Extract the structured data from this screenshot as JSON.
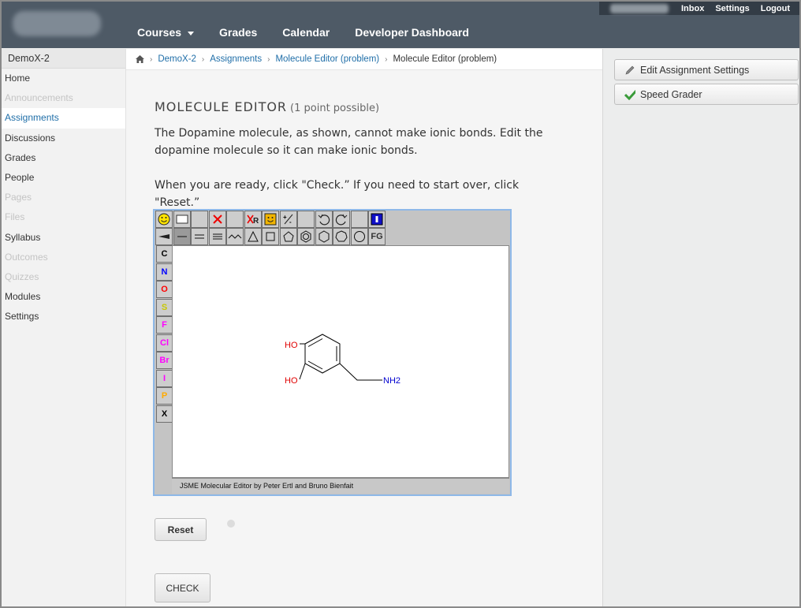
{
  "header": {
    "util_links": [
      "Inbox",
      "Settings",
      "Logout"
    ],
    "nav": [
      {
        "label": "Courses",
        "dropdown": true
      },
      {
        "label": "Grades"
      },
      {
        "label": "Calendar"
      },
      {
        "label": "Developer Dashboard"
      }
    ]
  },
  "sidebar": {
    "course": "DemoX-2",
    "items": [
      {
        "label": "Home",
        "state": "normal"
      },
      {
        "label": "Announcements",
        "state": "dim"
      },
      {
        "label": "Assignments",
        "state": "active"
      },
      {
        "label": "Discussions",
        "state": "normal"
      },
      {
        "label": "Grades",
        "state": "normal"
      },
      {
        "label": "People",
        "state": "normal"
      },
      {
        "label": "Pages",
        "state": "dim"
      },
      {
        "label": "Files",
        "state": "dim"
      },
      {
        "label": "Syllabus",
        "state": "normal"
      },
      {
        "label": "Outcomes",
        "state": "dim"
      },
      {
        "label": "Quizzes",
        "state": "dim"
      },
      {
        "label": "Modules",
        "state": "normal"
      },
      {
        "label": "Settings",
        "state": "normal"
      }
    ]
  },
  "breadcrumb": [
    "DemoX-2",
    "Assignments",
    "Molecule Editor (problem)",
    "Molecule Editor (problem)"
  ],
  "problem": {
    "title": "MOLECULE EDITOR",
    "points": "(1 point possible)",
    "text1": "The Dopamine molecule, as shown, cannot make ionic bonds. Edit the dopamine molecule so it can make ionic bonds.",
    "text2": "When you are ready, click \"Check.” If you need to start over, click \"Reset.”"
  },
  "editor": {
    "atom_buttons": [
      {
        "label": "C",
        "color": "#000000"
      },
      {
        "label": "N",
        "color": "#0000ff"
      },
      {
        "label": "O",
        "color": "#ff0000"
      },
      {
        "label": "S",
        "color": "#c8c800"
      },
      {
        "label": "F",
        "color": "#ff00ff"
      },
      {
        "label": "Cl",
        "color": "#ff00ff"
      },
      {
        "label": "Br",
        "color": "#ff00ff"
      },
      {
        "label": "I",
        "color": "#ff00ff"
      },
      {
        "label": "P",
        "color": "#ffaa00"
      },
      {
        "label": "X",
        "color": "#000000"
      }
    ],
    "fg_label": "FG",
    "molecule_labels": {
      "oh1": "HO",
      "oh2": "HO",
      "amine": "NH2"
    },
    "footer": "JSME Molecular Editor by Peter Ertl and Bruno Bienfait"
  },
  "buttons": {
    "reset": "Reset",
    "check": "CHECK"
  },
  "right": {
    "edit": "Edit Assignment Settings",
    "grader": "Speed Grader"
  }
}
